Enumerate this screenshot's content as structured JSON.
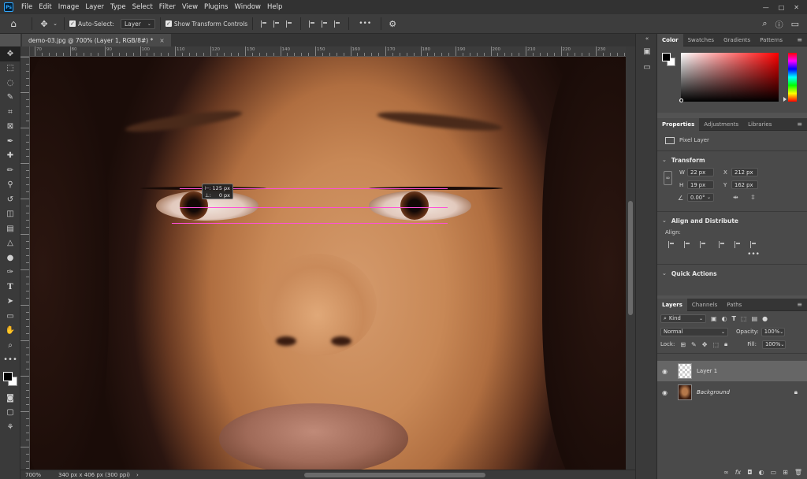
{
  "menu": {
    "logo": "Ps",
    "items": [
      "File",
      "Edit",
      "Image",
      "Layer",
      "Type",
      "Select",
      "Filter",
      "View",
      "Plugins",
      "Window",
      "Help"
    ]
  },
  "options": {
    "auto_select_label": "Auto-Select:",
    "auto_select_value": "Layer",
    "show_transform_label": "Show Transform Controls",
    "more": "•••"
  },
  "document": {
    "tab_title": "demo-03.jpg @ 700% (Layer 1, RGB/8#) *",
    "close": "×"
  },
  "ruler": {
    "h_labels": [
      "70",
      "80",
      "90",
      "100",
      "110",
      "120",
      "130",
      "140",
      "150",
      "160",
      "170",
      "180",
      "190",
      "200",
      "210",
      "220",
      "230"
    ]
  },
  "measure_tooltip": {
    "width_label": "⊢:",
    "width_value": "125 px",
    "height_label": "⊥:",
    "height_value": "0 px"
  },
  "status": {
    "zoom": "700%",
    "doc_size": "340 px x 406 px (300 ppi)"
  },
  "color_panel": {
    "tabs": [
      "Color",
      "Swatches",
      "Gradients",
      "Patterns"
    ],
    "active_tab": "Color",
    "foreground": "#000000",
    "background": "#ffffff"
  },
  "properties_panel": {
    "tabs": [
      "Properties",
      "Adjustments",
      "Libraries"
    ],
    "layer_type": "Pixel Layer",
    "transform_title": "Transform",
    "w_label": "W",
    "w_value": "22 px",
    "h_label": "H",
    "h_value": "19 px",
    "x_label": "X",
    "x_value": "212 px",
    "y_label": "Y",
    "y_value": "162 px",
    "angle_value": "0.00°",
    "align_title": "Align and Distribute",
    "align_label": "Align:",
    "quick_actions_title": "Quick Actions",
    "more": "•••"
  },
  "layers_panel": {
    "tabs": [
      "Layers",
      "Channels",
      "Paths"
    ],
    "filter_kind": "Kind",
    "blend_mode": "Normal",
    "opacity_label": "Opacity:",
    "opacity_value": "100%",
    "lock_label": "Lock:",
    "fill_label": "Fill:",
    "fill_value": "100%",
    "layers": [
      {
        "name": "Layer 1",
        "selected": true
      },
      {
        "name": "Background",
        "selected": false
      }
    ]
  },
  "guides_color": "#ff4fd8"
}
